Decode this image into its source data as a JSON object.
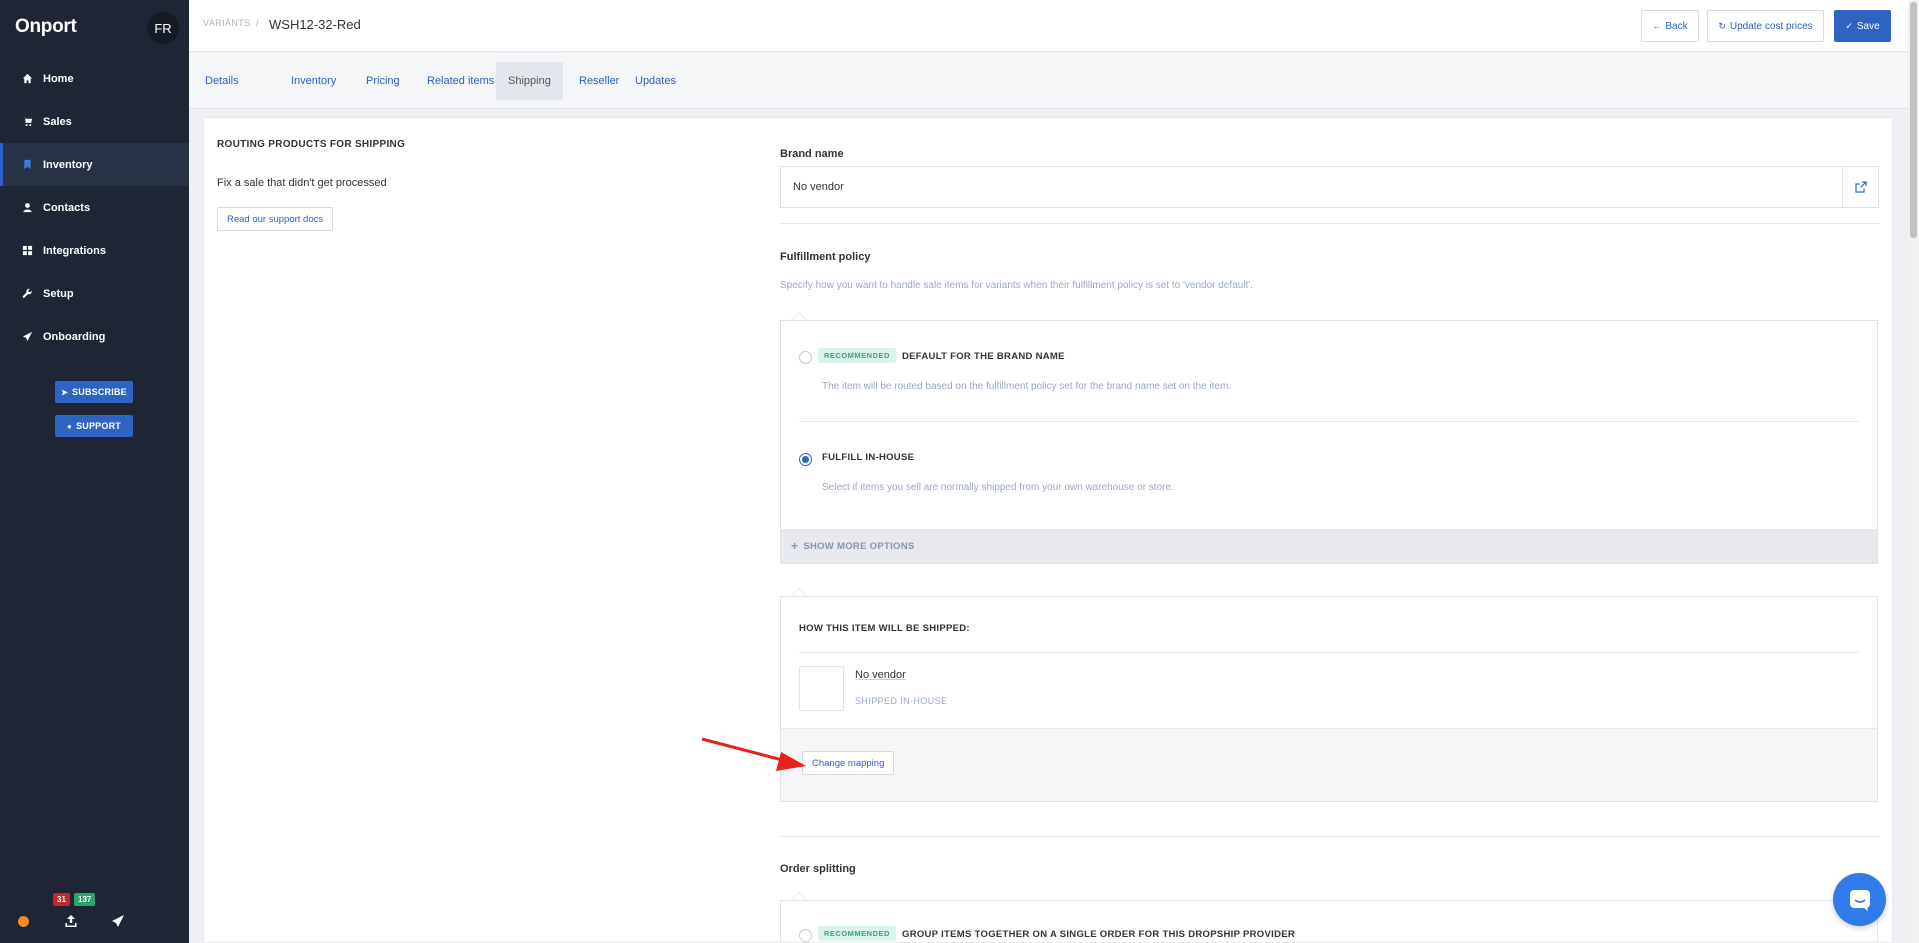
{
  "app": {
    "brand": "Onport",
    "avatar_initials": "FR"
  },
  "sidebar": {
    "items": [
      {
        "label": "Home",
        "icon": "home-icon"
      },
      {
        "label": "Sales",
        "icon": "cart-icon"
      },
      {
        "label": "Inventory",
        "icon": "bookmark-icon",
        "active": true
      },
      {
        "label": "Contacts",
        "icon": "user-icon"
      },
      {
        "label": "Integrations",
        "icon": "grid-icon"
      },
      {
        "label": "Setup",
        "icon": "wrench-icon"
      },
      {
        "label": "Onboarding",
        "icon": "rocket-icon"
      }
    ],
    "subscribe_label": "SUBSCRIBE",
    "support_label": "SUPPORT",
    "badge_red": "31",
    "badge_green": "137"
  },
  "header": {
    "breadcrumb": "VARIANTS",
    "separator": "/",
    "title": "WSH12-32-Red",
    "back_label": "Back",
    "update_cost_label": "Update cost prices",
    "save_label": "Save"
  },
  "tabs": [
    "Details",
    "Inventory",
    "Pricing",
    "Related items",
    "Shipping",
    "Reseller",
    "Updates"
  ],
  "active_tab": "Shipping",
  "left": {
    "title": "ROUTING PRODUCTS FOR SHIPPING",
    "text": "Fix a sale that didn't get processed",
    "docs_label": "Read our support docs"
  },
  "brand_name": {
    "label": "Brand name",
    "value": "No vendor"
  },
  "fulfillment": {
    "label": "Fulfillment policy",
    "help": "Specify how you want to handle sale items for variants when their fulfillment policy is set to 'vendor default'.",
    "recommended_label": "RECOMMENDED",
    "option1_title": "DEFAULT FOR THE BRAND NAME",
    "option1_desc": "The item will be routed based on the fulfillment policy set for the brand name set on the item.",
    "option2_title": "FULFILL IN-HOUSE",
    "option2_desc": "Select if items you sell are normally shipped from your own warehouse or store.",
    "show_more_label": "SHOW MORE OPTIONS"
  },
  "shipped": {
    "title": "HOW THIS ITEM WILL BE SHIPPED:",
    "vendor": "No vendor",
    "status": "SHIPPED IN-HOUSE",
    "change_label": "Change mapping"
  },
  "order_splitting": {
    "label": "Order splitting",
    "recommended_label": "RECOMMENDED",
    "option1_title": "GROUP ITEMS TOGETHER ON A SINGLE ORDER FOR THIS DROPSHIP PROVIDER"
  },
  "colors": {
    "sidebar_bg": "#1e2636",
    "primary": "#2e63c4",
    "annotation_arrow": "#e8221b"
  }
}
